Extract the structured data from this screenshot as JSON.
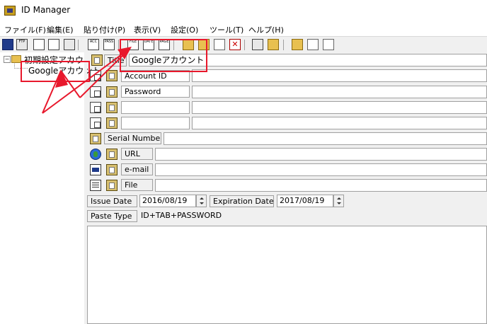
{
  "window": {
    "title": "ID Manager"
  },
  "menu": [
    "ファイル(F)",
    "編集(E)",
    "貼り付け(P)",
    "表示(V)",
    "設定(O)",
    "ツール(T)",
    "ヘルプ(H)"
  ],
  "toolbar": {
    "ftp_label": "FTP",
    "acc_label": "ACC",
    "pass_label": "PASS",
    "file_label": "FILE",
    "date_label": "DATE",
    "page_label": "PAGE",
    "del_label": "✕"
  },
  "tree": {
    "root_label": "初期設定アカウ",
    "child_label": "Googleアカウント"
  },
  "form": {
    "title_label": "Title",
    "title_value": "Googleアカウント",
    "account_label": "Account ID",
    "password_label": "Password",
    "serial_label": "Serial Number",
    "url_label": "URL",
    "email_label": "e-mail",
    "file_label": "File",
    "issue_label": "Issue Date",
    "issue_value": "2016/08/19",
    "expiration_label": "Expiration Date",
    "expiration_value": "2017/08/19",
    "paste_label": "Paste Type",
    "paste_value": "ID+TAB+PASSWORD"
  },
  "colors": {
    "highlight": "#e8182c"
  }
}
